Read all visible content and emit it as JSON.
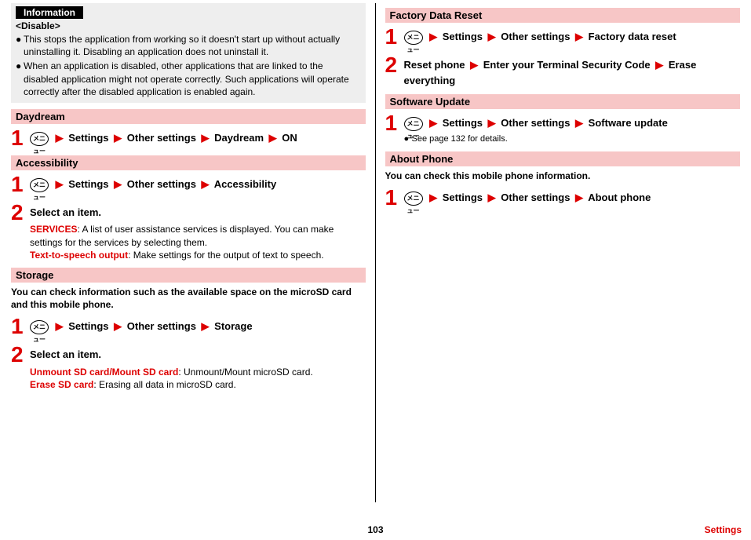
{
  "info": {
    "badge": "Information",
    "subhead": "<Disable>",
    "bullets": [
      "This stops the application from working so it doesn't start up without actually uninstalling it. Disabling an application does not uninstall it.",
      "When an application is disabled, other applications that are linked to the disabled application might not operate correctly. Such applications will operate correctly after the disabled application is enabled again."
    ]
  },
  "menuLabel": "メニュー",
  "arrow": "▶",
  "pageNumber": "103",
  "pageLabel": "Settings",
  "sections": {
    "daydream": {
      "title": "Daydream",
      "step1Parts": [
        "Settings",
        "Other settings",
        "Daydream",
        "ON"
      ]
    },
    "accessibility": {
      "title": "Accessibility",
      "step1Parts": [
        "Settings",
        "Other settings",
        "Accessibility"
      ],
      "step2Title": "Select an item.",
      "items": [
        {
          "term": "SERVICES",
          "desc": ": A list of user assistance services is displayed. You can make settings for the services by selecting them."
        },
        {
          "term": "Text-to-speech output",
          "desc": ": Make settings for the output of text to speech."
        }
      ]
    },
    "storage": {
      "title": "Storage",
      "intro": "You can check information such as the available space on the microSD card and this mobile phone.",
      "step1Parts": [
        "Settings",
        "Other settings",
        "Storage"
      ],
      "step2Title": "Select an item.",
      "items": [
        {
          "term": "Unmount SD card/Mount SD card",
          "desc": ": Unmount/Mount microSD card."
        },
        {
          "term": "Erase SD card",
          "desc": ": Erasing all data in microSD card."
        }
      ]
    },
    "factory": {
      "title": "Factory Data Reset",
      "step1Parts": [
        "Settings",
        "Other settings",
        "Factory data reset"
      ],
      "step2Parts": [
        "Reset phone",
        "Enter your Terminal Security Code",
        "Erase everything"
      ]
    },
    "software": {
      "title": "Software Update",
      "step1Parts": [
        "Settings",
        "Other settings",
        "Software update"
      ],
      "note": "See page 132  for details."
    },
    "about": {
      "title": "About Phone",
      "intro": "You can check this mobile phone information.",
      "step1Parts": [
        "Settings",
        "Other settings",
        "About phone"
      ]
    }
  }
}
